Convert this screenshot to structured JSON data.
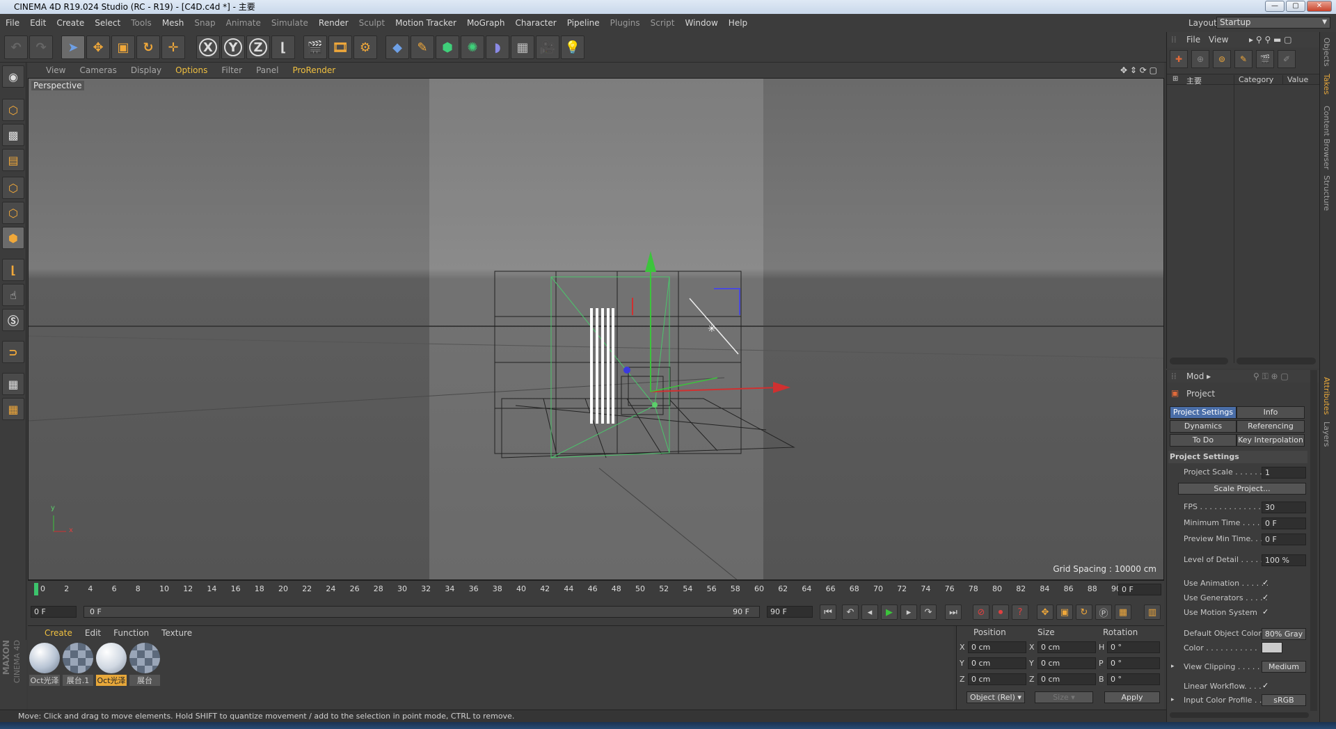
{
  "window": {
    "title": "CINEMA 4D R19.024 Studio (RC - R19) - [C4D.c4d *] - 主要"
  },
  "menu": [
    "File",
    "Edit",
    "Create",
    "Select",
    "Tools",
    "Mesh",
    "Snap",
    "Animate",
    "Simulate",
    "Render",
    "Sculpt",
    "Motion Tracker",
    "MoGraph",
    "Character",
    "Pipeline",
    "Plugins",
    "Script",
    "Window",
    "Help"
  ],
  "layout": {
    "label": "Layout:",
    "value": "Startup"
  },
  "toolbar": {
    "x_label": "X",
    "y_label": "Y",
    "z_label": "Z"
  },
  "viewport": {
    "menu": [
      "View",
      "Cameras",
      "Display",
      "Options",
      "Filter",
      "Panel",
      "ProRender"
    ],
    "label": "Perspective",
    "grid_spacing": "Grid Spacing : 10000 cm",
    "axis_y": "y",
    "axis_x": "x"
  },
  "timeline": {
    "ticks": [
      "0",
      "2",
      "4",
      "6",
      "8",
      "10",
      "12",
      "14",
      "16",
      "18",
      "20",
      "22",
      "24",
      "26",
      "28",
      "30",
      "32",
      "34",
      "36",
      "38",
      "40",
      "42",
      "44",
      "46",
      "48",
      "50",
      "52",
      "54",
      "56",
      "58",
      "60",
      "62",
      "64",
      "66",
      "68",
      "70",
      "72",
      "74",
      "76",
      "78",
      "80",
      "82",
      "84",
      "86",
      "88",
      "90"
    ],
    "current_frame": "0 F"
  },
  "playback": {
    "start": "0 F",
    "slider_start": "0 F",
    "slider_end": "90 F",
    "end": "90 F"
  },
  "materials": {
    "menu": [
      "Create",
      "Edit",
      "Function",
      "Texture"
    ],
    "items": [
      {
        "label": "Oct光泽"
      },
      {
        "label": "展台.1"
      },
      {
        "label": "Oct光泽"
      },
      {
        "label": "展台"
      }
    ]
  },
  "coords": {
    "headers": {
      "position": "Position",
      "size": "Size",
      "rotation": "Rotation"
    },
    "rows": [
      {
        "pos_axis": "X",
        "pos": "0 cm",
        "size_axis": "X",
        "size": "0 cm",
        "rot_axis": "H",
        "rot": "0 °"
      },
      {
        "pos_axis": "Y",
        "pos": "0 cm",
        "size_axis": "Y",
        "size": "0 cm",
        "rot_axis": "P",
        "rot": "0 °"
      },
      {
        "pos_axis": "Z",
        "pos": "0 cm",
        "size_axis": "Z",
        "size": "0 cm",
        "rot_axis": "B",
        "rot": "0 °"
      }
    ],
    "mode": "Object (Rel)",
    "size_mode": "Size",
    "apply": "Apply"
  },
  "status": "Move: Click and drag to move elements. Hold SHIFT to quantize movement / add to the selection in point mode, CTRL to remove.",
  "brand": {
    "maxon": "MAXON",
    "product": "CINEMA 4D"
  },
  "objects_panel": {
    "menu": [
      "File",
      "View"
    ],
    "header_name": "主要",
    "header_category": "Category",
    "header_value": "Value"
  },
  "attributes": {
    "mode": "Mod",
    "object": "Project",
    "tabs": [
      "Project Settings",
      "Info",
      "Dynamics",
      "Referencing",
      "To Do",
      "Key Interpolation"
    ],
    "section": "Project Settings",
    "project_scale_label": "Project Scale . . . . . . .",
    "project_scale": "1",
    "scale_project_btn": "Scale Project...",
    "fps_label": "FPS . . . . . . . . . . . . . . .",
    "fps": "30",
    "min_time_label": "Minimum Time . . . . .",
    "min_time": "0 F",
    "preview_min_label": "Preview Min Time. . .",
    "preview_min": "0 F",
    "lod_label": "Level of Detail . . . . . .",
    "lod": "100 %",
    "use_anim_label": "Use Animation . . . . . .",
    "use_gen_label": "Use Generators . . . . .",
    "use_motion_label": "Use Motion System",
    "check": "✓",
    "default_color_label": "Default Object Color",
    "default_color": "80% Gray",
    "color_label": "Color . . . . . . . . . . .",
    "view_clip_label": "View Clipping . . . . . .",
    "view_clip": "Medium",
    "linear_label": "Linear Workflow. . . .",
    "input_profile_label": "Input Color Profile . .",
    "input_profile": "sRGB"
  },
  "side_tabs": [
    "Objects",
    "Takes",
    "Content Browser",
    "Structure",
    "Attributes",
    "Layers"
  ]
}
